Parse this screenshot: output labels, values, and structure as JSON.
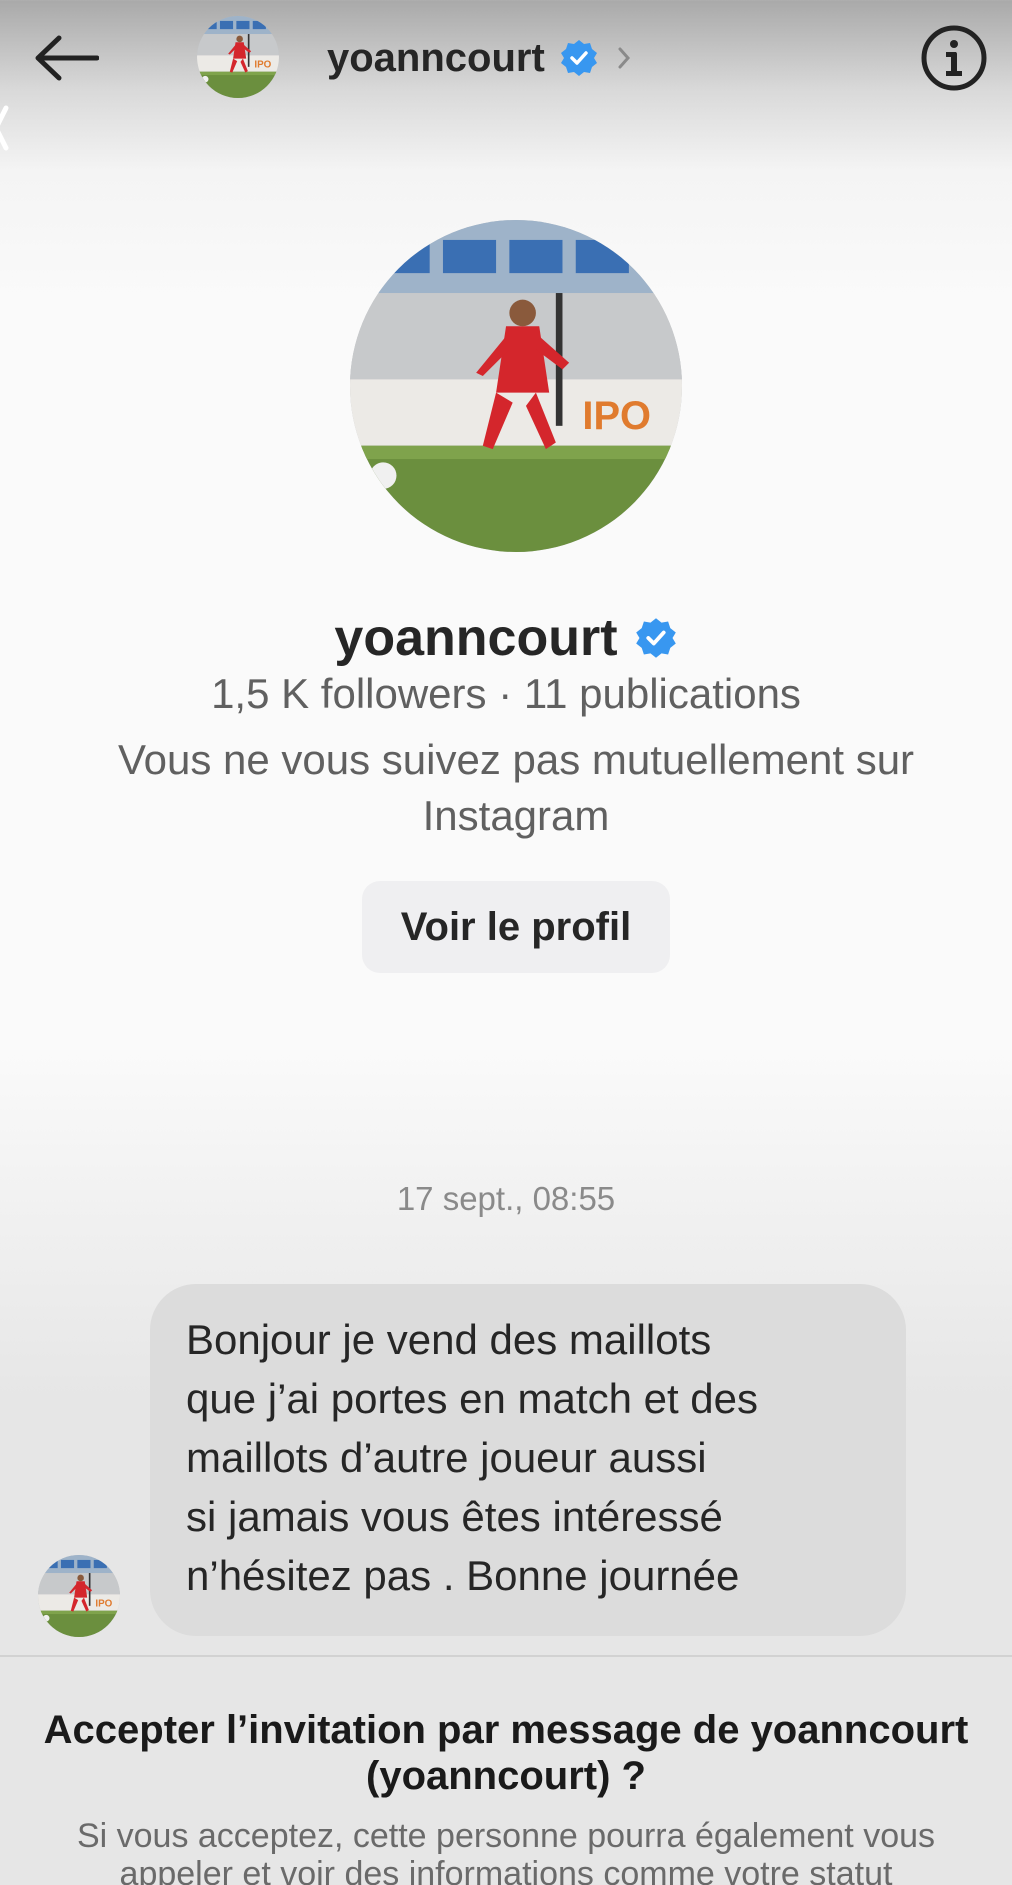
{
  "header": {
    "username": "yoanncourt"
  },
  "profile": {
    "name": "yoanncourt",
    "stats": "1,5 K followers · 11 publications",
    "mutual": "Vous ne vous suivez pas mutuellement sur Instagram",
    "view_profile_label": "Voir le profil"
  },
  "conversation": {
    "timestamp": "17 sept., 08:55",
    "message": "Bonjour je vend des maillots\nque j’ai portes en match et des\nmaillots d’autre joueur aussi\nsi jamais vous êtes intéressé\nn’hésitez pas . Bonne journée"
  },
  "invite": {
    "title_prefix": "Accepter l’invitation par message de ",
    "title_name": "yoanncourt",
    "title_suffix": "(yoanncourt) ?",
    "description": "Si vous acceptez, cette personne pourra également vous appeler et voir des informations comme votre statut"
  },
  "colors": {
    "verified": "#3897f0",
    "bubble": "#dcdcdc",
    "secondary_text": "#606060"
  },
  "icons": {
    "back": "arrow-left-icon",
    "info": "info-circle-icon",
    "verified": "verified-badge-icon",
    "chevron": "chevron-right-icon"
  }
}
